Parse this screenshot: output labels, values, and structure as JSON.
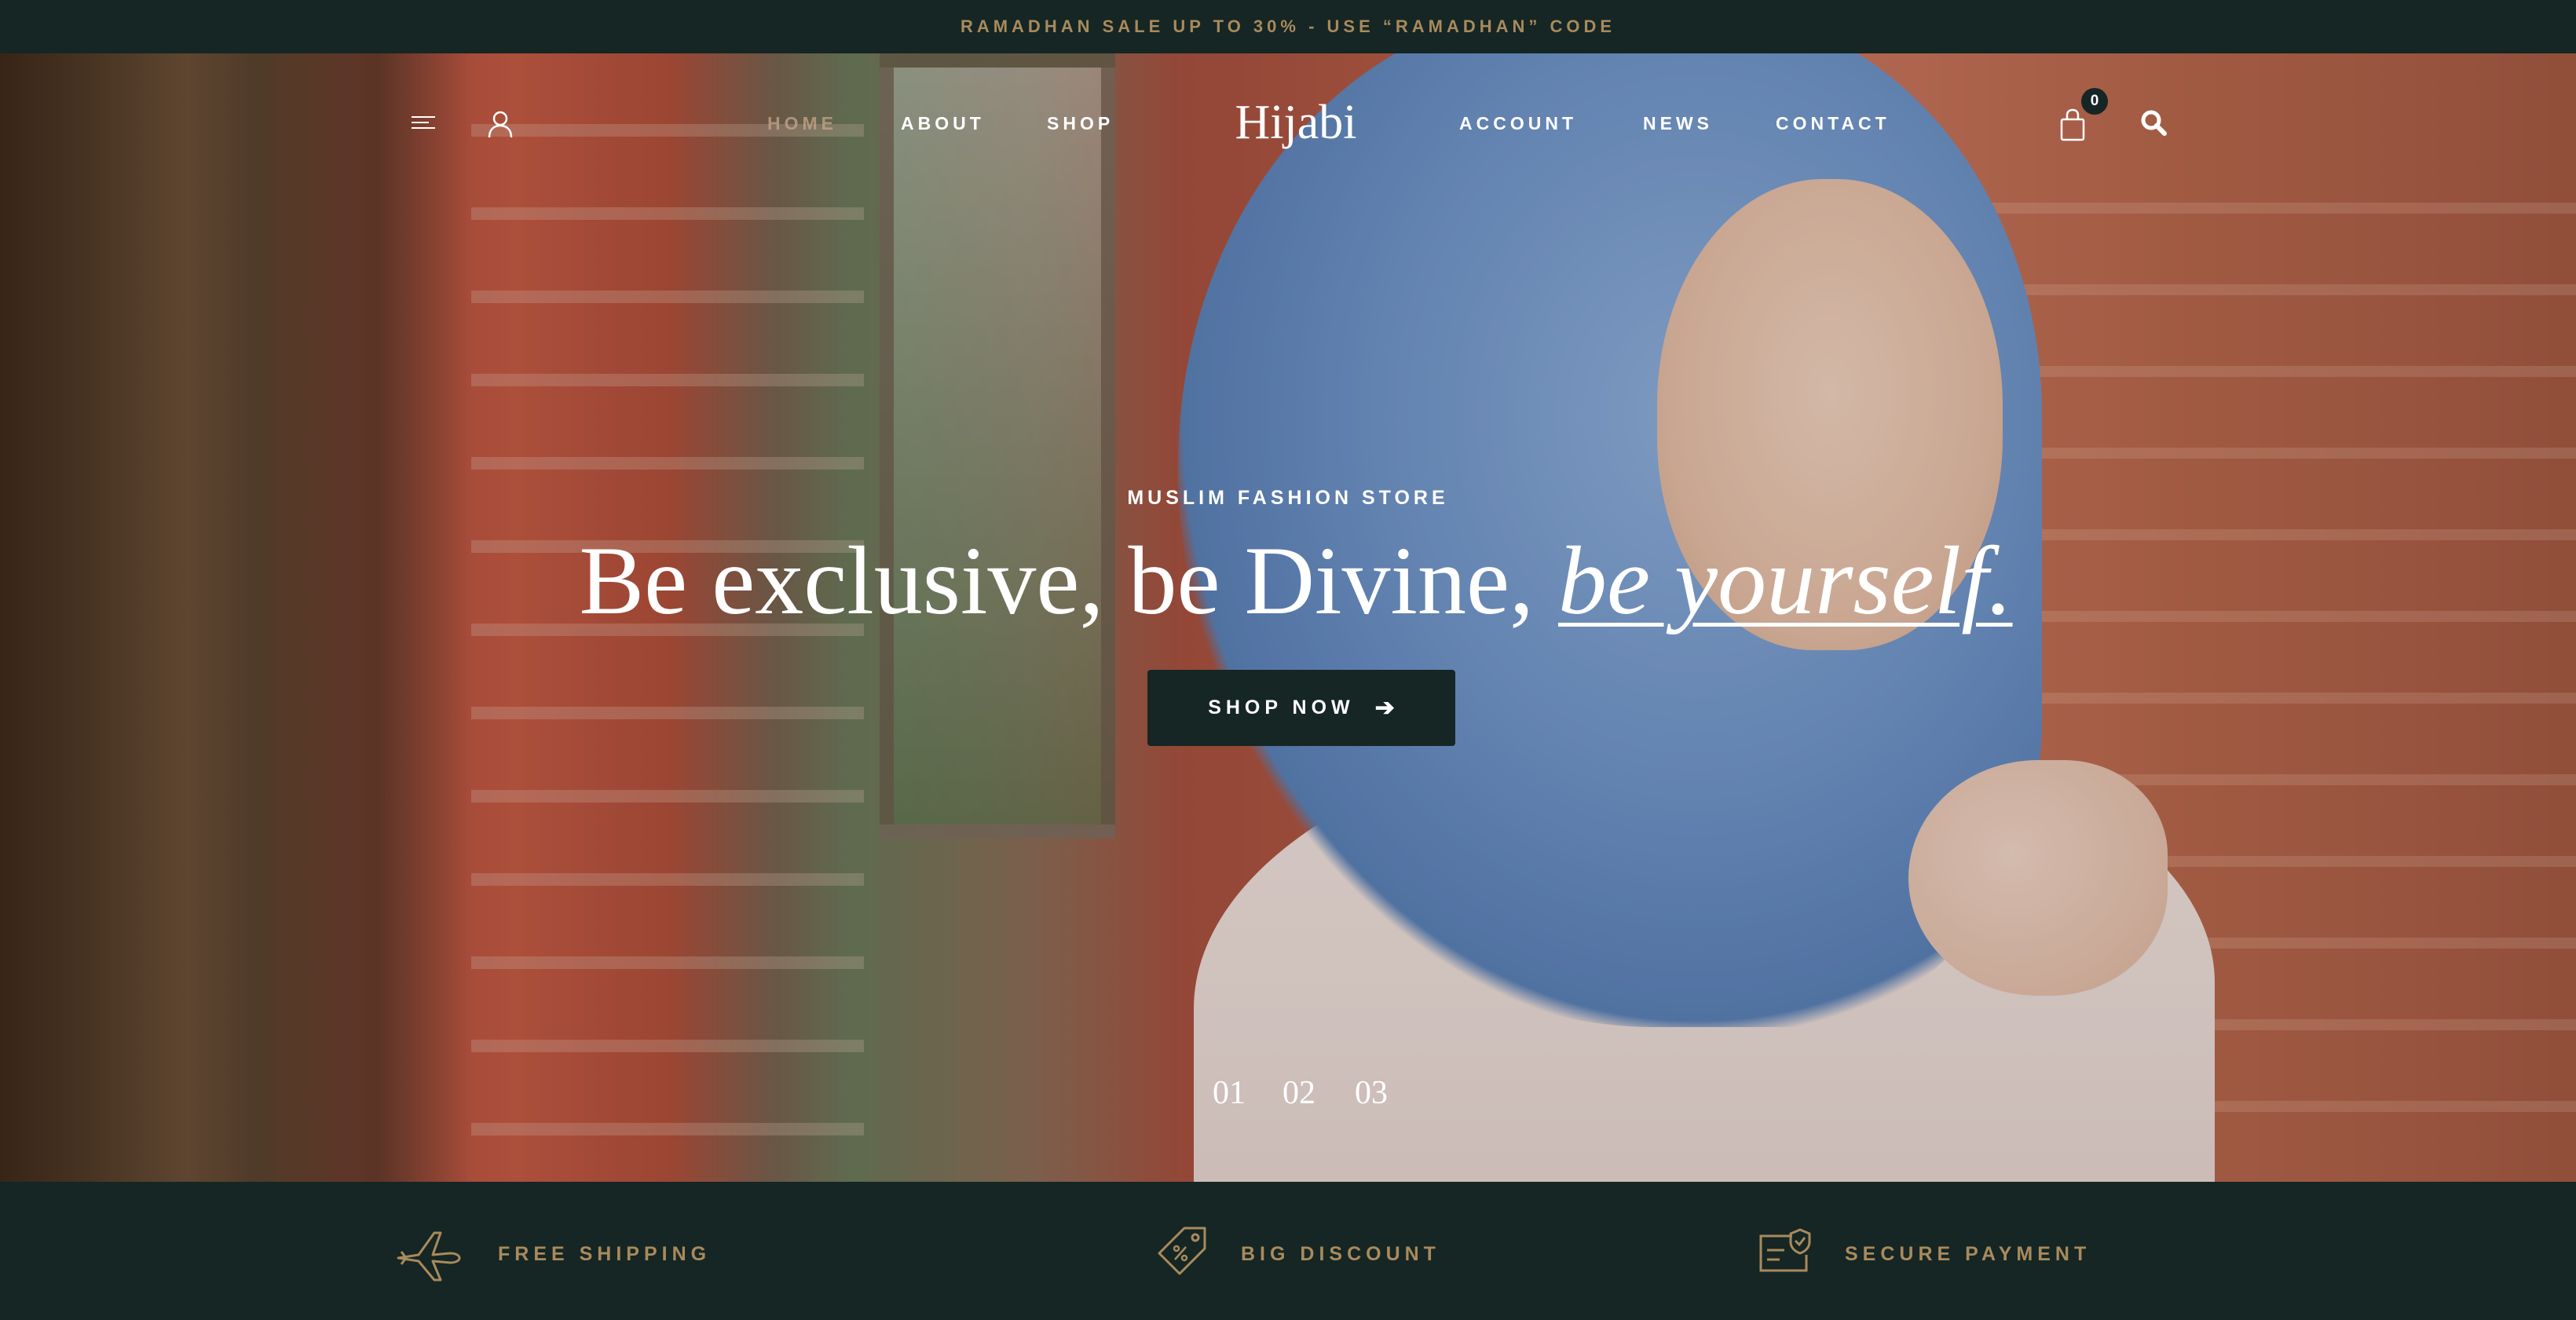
{
  "announcement": {
    "text": "RAMADHAN SALE UP TO 30% - USE “RAMADHAN” CODE"
  },
  "nav": {
    "left_links": [
      "HOME",
      "ABOUT",
      "SHOP"
    ],
    "right_links": [
      "ACCOUNT",
      "NEWS",
      "CONTACT"
    ],
    "active": "HOME",
    "logo": "Hijabi",
    "cart_count": "0",
    "icons": [
      "menu-icon",
      "user-icon",
      "cart-icon",
      "search-icon"
    ]
  },
  "hero": {
    "eyebrow": "MUSLIM FASHION STORE",
    "headline_main": "Be exclusive, be Divine, ",
    "headline_emphasis": "be yourself.",
    "cta_label": "SHOP NOW",
    "cta_icon": "arrow-right-icon",
    "slides": [
      "01",
      "02",
      "03"
    ]
  },
  "features": [
    {
      "label": "FREE SHIPPING",
      "icon": "airplane-icon"
    },
    {
      "label": "BIG DISCOUNT",
      "icon": "price-tag-icon"
    },
    {
      "label": "SECURE PAYMENT",
      "icon": "secure-payment-icon"
    }
  ],
  "colors": {
    "dark": "#152624",
    "gold": "#a98a5c",
    "active_nav": "#c7a78a"
  }
}
